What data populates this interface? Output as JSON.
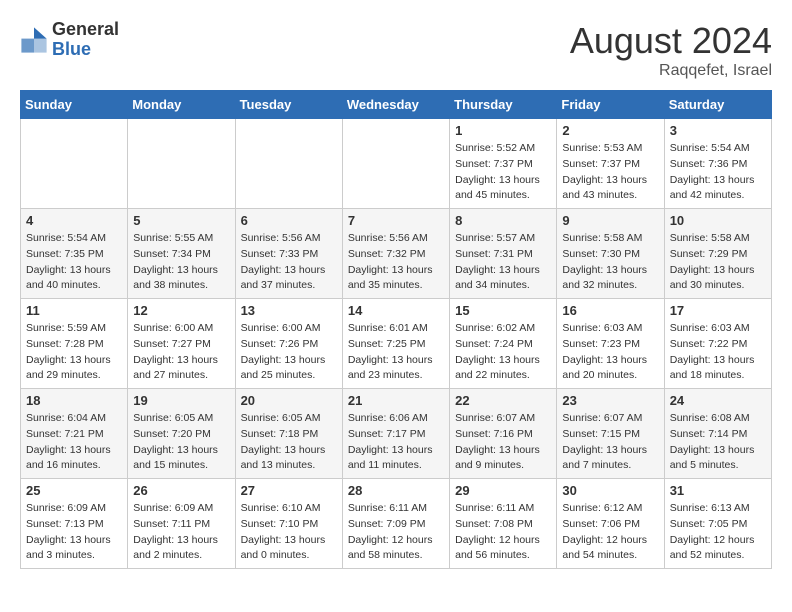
{
  "logo": {
    "general": "General",
    "blue": "Blue"
  },
  "title": "August 2024",
  "location": "Raqqefet, Israel",
  "days_header": [
    "Sunday",
    "Monday",
    "Tuesday",
    "Wednesday",
    "Thursday",
    "Friday",
    "Saturday"
  ],
  "weeks": [
    [
      {
        "num": "",
        "info": ""
      },
      {
        "num": "",
        "info": ""
      },
      {
        "num": "",
        "info": ""
      },
      {
        "num": "",
        "info": ""
      },
      {
        "num": "1",
        "info": "Sunrise: 5:52 AM\nSunset: 7:37 PM\nDaylight: 13 hours and 45 minutes."
      },
      {
        "num": "2",
        "info": "Sunrise: 5:53 AM\nSunset: 7:37 PM\nDaylight: 13 hours and 43 minutes."
      },
      {
        "num": "3",
        "info": "Sunrise: 5:54 AM\nSunset: 7:36 PM\nDaylight: 13 hours and 42 minutes."
      }
    ],
    [
      {
        "num": "4",
        "info": "Sunrise: 5:54 AM\nSunset: 7:35 PM\nDaylight: 13 hours and 40 minutes."
      },
      {
        "num": "5",
        "info": "Sunrise: 5:55 AM\nSunset: 7:34 PM\nDaylight: 13 hours and 38 minutes."
      },
      {
        "num": "6",
        "info": "Sunrise: 5:56 AM\nSunset: 7:33 PM\nDaylight: 13 hours and 37 minutes."
      },
      {
        "num": "7",
        "info": "Sunrise: 5:56 AM\nSunset: 7:32 PM\nDaylight: 13 hours and 35 minutes."
      },
      {
        "num": "8",
        "info": "Sunrise: 5:57 AM\nSunset: 7:31 PM\nDaylight: 13 hours and 34 minutes."
      },
      {
        "num": "9",
        "info": "Sunrise: 5:58 AM\nSunset: 7:30 PM\nDaylight: 13 hours and 32 minutes."
      },
      {
        "num": "10",
        "info": "Sunrise: 5:58 AM\nSunset: 7:29 PM\nDaylight: 13 hours and 30 minutes."
      }
    ],
    [
      {
        "num": "11",
        "info": "Sunrise: 5:59 AM\nSunset: 7:28 PM\nDaylight: 13 hours and 29 minutes."
      },
      {
        "num": "12",
        "info": "Sunrise: 6:00 AM\nSunset: 7:27 PM\nDaylight: 13 hours and 27 minutes."
      },
      {
        "num": "13",
        "info": "Sunrise: 6:00 AM\nSunset: 7:26 PM\nDaylight: 13 hours and 25 minutes."
      },
      {
        "num": "14",
        "info": "Sunrise: 6:01 AM\nSunset: 7:25 PM\nDaylight: 13 hours and 23 minutes."
      },
      {
        "num": "15",
        "info": "Sunrise: 6:02 AM\nSunset: 7:24 PM\nDaylight: 13 hours and 22 minutes."
      },
      {
        "num": "16",
        "info": "Sunrise: 6:03 AM\nSunset: 7:23 PM\nDaylight: 13 hours and 20 minutes."
      },
      {
        "num": "17",
        "info": "Sunrise: 6:03 AM\nSunset: 7:22 PM\nDaylight: 13 hours and 18 minutes."
      }
    ],
    [
      {
        "num": "18",
        "info": "Sunrise: 6:04 AM\nSunset: 7:21 PM\nDaylight: 13 hours and 16 minutes."
      },
      {
        "num": "19",
        "info": "Sunrise: 6:05 AM\nSunset: 7:20 PM\nDaylight: 13 hours and 15 minutes."
      },
      {
        "num": "20",
        "info": "Sunrise: 6:05 AM\nSunset: 7:18 PM\nDaylight: 13 hours and 13 minutes."
      },
      {
        "num": "21",
        "info": "Sunrise: 6:06 AM\nSunset: 7:17 PM\nDaylight: 13 hours and 11 minutes."
      },
      {
        "num": "22",
        "info": "Sunrise: 6:07 AM\nSunset: 7:16 PM\nDaylight: 13 hours and 9 minutes."
      },
      {
        "num": "23",
        "info": "Sunrise: 6:07 AM\nSunset: 7:15 PM\nDaylight: 13 hours and 7 minutes."
      },
      {
        "num": "24",
        "info": "Sunrise: 6:08 AM\nSunset: 7:14 PM\nDaylight: 13 hours and 5 minutes."
      }
    ],
    [
      {
        "num": "25",
        "info": "Sunrise: 6:09 AM\nSunset: 7:13 PM\nDaylight: 13 hours and 3 minutes."
      },
      {
        "num": "26",
        "info": "Sunrise: 6:09 AM\nSunset: 7:11 PM\nDaylight: 13 hours and 2 minutes."
      },
      {
        "num": "27",
        "info": "Sunrise: 6:10 AM\nSunset: 7:10 PM\nDaylight: 13 hours and 0 minutes."
      },
      {
        "num": "28",
        "info": "Sunrise: 6:11 AM\nSunset: 7:09 PM\nDaylight: 12 hours and 58 minutes."
      },
      {
        "num": "29",
        "info": "Sunrise: 6:11 AM\nSunset: 7:08 PM\nDaylight: 12 hours and 56 minutes."
      },
      {
        "num": "30",
        "info": "Sunrise: 6:12 AM\nSunset: 7:06 PM\nDaylight: 12 hours and 54 minutes."
      },
      {
        "num": "31",
        "info": "Sunrise: 6:13 AM\nSunset: 7:05 PM\nDaylight: 12 hours and 52 minutes."
      }
    ]
  ]
}
